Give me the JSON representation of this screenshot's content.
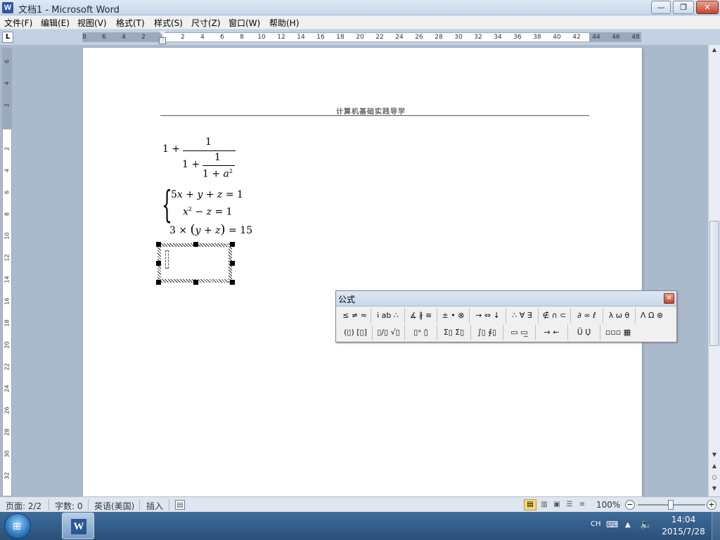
{
  "window": {
    "app_icon": "W",
    "title": "文档1 - Microsoft Word",
    "min_label": "—",
    "max_label": "❐",
    "close_label": "✕"
  },
  "menu": {
    "items": [
      "文件(F)",
      "编辑(E)",
      "视图(V)",
      "格式(T)",
      "样式(S)",
      "尺寸(Z)",
      "窗口(W)",
      "帮助(H)"
    ]
  },
  "ruler": {
    "tab_label": "L",
    "h_numbers": [
      "8",
      "6",
      "4",
      "2",
      "",
      "2",
      "4",
      "6",
      "8",
      "10",
      "12",
      "14",
      "16",
      "18",
      "20",
      "22",
      "24",
      "26",
      "28",
      "30",
      "32",
      "34",
      "36",
      "38",
      "40",
      "42",
      "44",
      "46",
      "48"
    ],
    "v_numbers": [
      "6",
      "4",
      "2",
      "",
      "2",
      "4",
      "6",
      "8",
      "10",
      "12",
      "14",
      "16",
      "18",
      "20",
      "22",
      "24",
      "26",
      "28",
      "30",
      "32"
    ]
  },
  "document": {
    "header": "计算机基础实践导学",
    "eq1": {
      "lead": "1 + ",
      "num1": "1",
      "den_lead": "1 + ",
      "num2": "1",
      "den2_base": "1 + ",
      "den2_var": "a",
      "den2_exp": "2"
    },
    "eq2": {
      "brace": "{",
      "row1_a": "5",
      "row1_x": "x",
      "row1_b": " + ",
      "row1_y": "y",
      "row1_c": " + ",
      "row1_z": "z",
      "row1_eq": " = 1",
      "row2_x": "x",
      "row2_exp": "2",
      "row2_b": " − ",
      "row2_z": "z",
      "row2_eq": " = 1",
      "row3_a": "3 × ",
      "row3_paren_l": "(",
      "row3_y": "y",
      "row3_b": " + ",
      "row3_z": "z",
      "row3_paren_r": ")",
      "row3_eq": " = 15"
    }
  },
  "formula_toolbar": {
    "title": "公式",
    "close": "✕",
    "row1": [
      "≤ ≠ ≈",
      "i̇ ab ∴",
      "∡ ∦ ≡",
      "± • ⊗",
      "→ ⇔ ↓",
      "∴ ∀ ∃",
      "∉ ∩ ⊂",
      "∂ ∞ ℓ",
      "λ ω θ",
      "Λ Ω ⊛"
    ],
    "row2": [
      "(▯) [▯]",
      "▯/▯ √▯",
      "▯ˣ ▯̇",
      "Σ▯ Σ▯",
      "∫▯ ∮▯",
      "▭ ▭̲",
      "→ ←",
      "Ū Ụ̇",
      "▫▫▫ ▦"
    ]
  },
  "statusbar": {
    "page": "页面: 2/2",
    "words": "字数: 0",
    "language": "英语(美国)",
    "mode": "插入",
    "zoom": "100%",
    "zoom_minus": "−",
    "zoom_plus": "+",
    "zoom_level_percent": 100
  },
  "taskbar": {
    "word_icon": "W",
    "ime": "CH",
    "time": "14:04",
    "date": "2015/7/28"
  },
  "colors": {
    "accent": "#2b5797",
    "workspace": "#abb9cc",
    "close_red": "#c4442c"
  }
}
